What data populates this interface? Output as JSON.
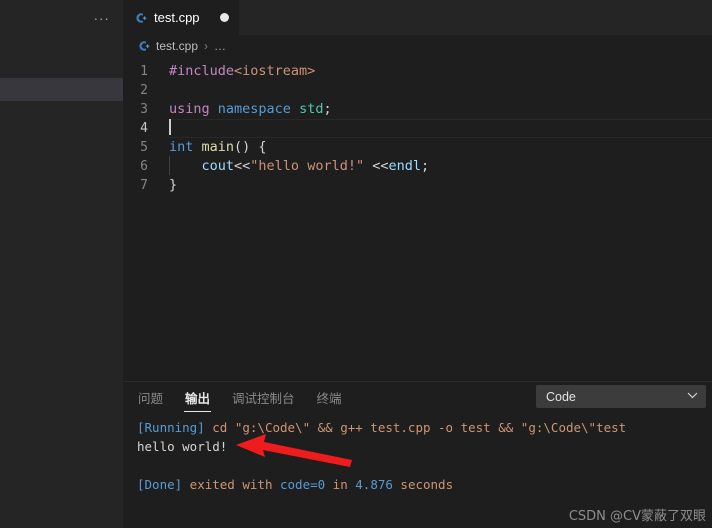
{
  "colors": {
    "editor_bg": "#1e1e1e",
    "sidebar_bg": "#252526",
    "tabbar_bg": "#252526",
    "selection_bg": "#37373d",
    "keyword_blue": "#569cd6",
    "control_magenta": "#c586c0",
    "type_teal": "#4ec9b0",
    "function_yellow": "#dcdcaa",
    "string_orange": "#ce9178",
    "variable_lightblue": "#9cdcfe",
    "arrow_red": "#ee1c1c",
    "dropdown_bg": "#3c3c3c"
  },
  "sidebar": {
    "more_actions_label": "...",
    "selected_row_label": ""
  },
  "tabs": [
    {
      "label": "test.cpp",
      "icon": "cpp-file-icon",
      "dirty": true,
      "active": true
    }
  ],
  "breadcrumb": {
    "icon": "cpp-file-icon",
    "file": "test.cpp",
    "separator": "›",
    "ellipsis": "…"
  },
  "editor": {
    "lines": [
      {
        "number": "1",
        "active": false,
        "indent_guide": false,
        "tokens": [
          {
            "text": "#include",
            "cls": "t-control"
          },
          {
            "text": "<iostream>",
            "cls": "t-string"
          }
        ]
      },
      {
        "number": "2",
        "active": false,
        "indent_guide": false,
        "tokens": []
      },
      {
        "number": "3",
        "active": false,
        "indent_guide": false,
        "tokens": [
          {
            "text": "using",
            "cls": "t-control"
          },
          {
            "text": " ",
            "cls": "t-plain"
          },
          {
            "text": "namespace",
            "cls": "t-keyword"
          },
          {
            "text": " ",
            "cls": "t-plain"
          },
          {
            "text": "std",
            "cls": "t-type"
          },
          {
            "text": ";",
            "cls": "t-punct"
          }
        ]
      },
      {
        "number": "4",
        "active": true,
        "indent_guide": false,
        "cursor": true,
        "tokens": []
      },
      {
        "number": "5",
        "active": false,
        "indent_guide": false,
        "tokens": [
          {
            "text": "int",
            "cls": "t-keyword"
          },
          {
            "text": " ",
            "cls": "t-plain"
          },
          {
            "text": "main",
            "cls": "t-func"
          },
          {
            "text": "() {",
            "cls": "t-punct"
          }
        ]
      },
      {
        "number": "6",
        "active": false,
        "indent_guide": true,
        "tokens": [
          {
            "text": "    ",
            "cls": "t-plain"
          },
          {
            "text": "cout",
            "cls": "t-var"
          },
          {
            "text": "<<",
            "cls": "t-op"
          },
          {
            "text": "\"hello world!\"",
            "cls": "t-string"
          },
          {
            "text": " ",
            "cls": "t-plain"
          },
          {
            "text": "<<",
            "cls": "t-op"
          },
          {
            "text": "endl",
            "cls": "t-var"
          },
          {
            "text": ";",
            "cls": "t-punct"
          }
        ]
      },
      {
        "number": "7",
        "active": false,
        "indent_guide": false,
        "tokens": [
          {
            "text": "}",
            "cls": "t-brace-y"
          }
        ]
      }
    ]
  },
  "panel": {
    "tabs": [
      {
        "label": "问题",
        "active": false
      },
      {
        "label": "输出",
        "active": true
      },
      {
        "label": "调试控制台",
        "active": false
      },
      {
        "label": "终端",
        "active": false
      }
    ],
    "channel_select": {
      "value": "Code",
      "chevron": "⌄"
    },
    "output_lines": [
      {
        "segments": [
          {
            "text": "[Running]",
            "cls": "out-tag"
          },
          {
            "text": " cd \"g:\\Code\\\" && g++ test.cpp -o test && \"g:\\Code\\\"test",
            "cls": "out-text"
          }
        ]
      },
      {
        "segments": [
          {
            "text": "hello world!",
            "cls": "out-white"
          }
        ]
      },
      {
        "segments": []
      },
      {
        "segments": [
          {
            "text": "[Done]",
            "cls": "out-tag"
          },
          {
            "text": " exited with ",
            "cls": "out-text"
          },
          {
            "text": "code=0",
            "cls": "out-num"
          },
          {
            "text": " in ",
            "cls": "out-text"
          },
          {
            "text": "4.876",
            "cls": "out-num"
          },
          {
            "text": " seconds",
            "cls": "out-text"
          }
        ]
      }
    ]
  },
  "annotation": {
    "arrow_name": "red-pointer-arrow",
    "points_at": "hello world!"
  },
  "watermark": {
    "text": "CSDN @CV蒙蔽了双眼"
  }
}
